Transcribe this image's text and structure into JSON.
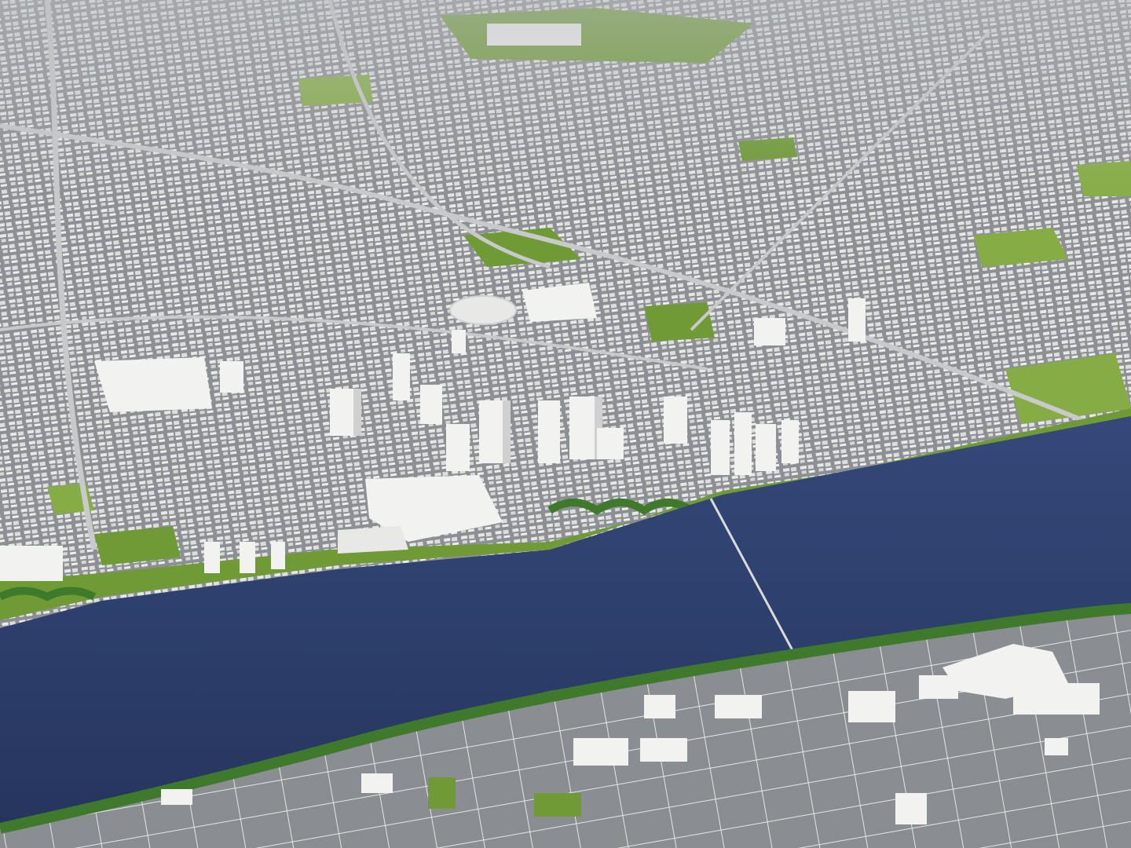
{
  "scene": {
    "kind": "aerial 3D render of a city model beside a wide river",
    "colors": {
      "sky_haze": "#b9bcc0",
      "asphalt": "#8c8f93",
      "road_line": "#e6e7e8",
      "grass": "#6f9a35",
      "grass_light": "#86ad45",
      "building": "#f2f2f0",
      "building_shadow": "#cfd0cf",
      "river": "#2a3b67",
      "river_light": "#34497a",
      "trees": "#3f7a2c"
    },
    "elements": [
      "north-urban-grid",
      "downtown-towers",
      "riverfront-park",
      "river",
      "bridge",
      "south-shore-district"
    ]
  }
}
